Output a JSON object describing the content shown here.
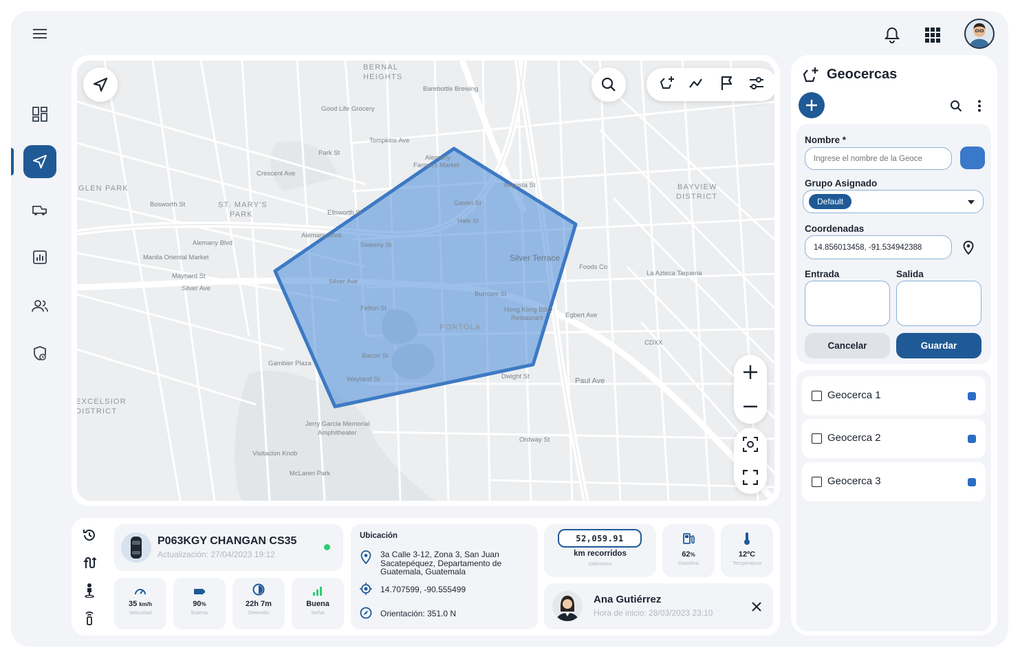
{
  "topbar": {
    "menu_icon": "hamburger-icon",
    "icons": [
      "bell-icon",
      "apps-grid-icon",
      "user-avatar"
    ]
  },
  "sidebar": {
    "items": [
      {
        "icon": "dashboard-icon",
        "active": false
      },
      {
        "icon": "navigation-icon",
        "active": true
      },
      {
        "icon": "vehicles-icon",
        "active": false
      },
      {
        "icon": "reports-icon",
        "active": false
      },
      {
        "icon": "users-icon",
        "active": false
      },
      {
        "icon": "shield-icon",
        "active": false
      }
    ]
  },
  "map": {
    "labels": [
      {
        "text": "BERNAL",
        "kind": "big"
      },
      {
        "text": "HEIGHTS",
        "kind": "big"
      },
      {
        "text": "Barebottle Brewing"
      },
      {
        "text": "Good Life Grocery"
      },
      {
        "text": "Tompkins Ave"
      },
      {
        "text": "Park St"
      },
      {
        "text": "Crescent Ave"
      },
      {
        "text": "GLEN PARK",
        "kind": "big"
      },
      {
        "text": "ST. MARY'S",
        "kind": "big"
      },
      {
        "text": "PARK",
        "kind": "big"
      },
      {
        "text": "Bosworth St"
      },
      {
        "text": "Ellsworth St"
      },
      {
        "text": "Alemany Blvd"
      },
      {
        "text": "Alemany Blvd"
      },
      {
        "text": "Manila Oriental Market"
      },
      {
        "text": "Maynard St"
      },
      {
        "text": "Silver Ave"
      },
      {
        "text": "Silver Ave"
      },
      {
        "text": "Silver Terrace"
      },
      {
        "text": "Foods Co"
      },
      {
        "text": "La Azteca Taqueria"
      },
      {
        "text": "BAYVIEW",
        "kind": "big"
      },
      {
        "text": "DISTRICT",
        "kind": "big"
      },
      {
        "text": "PORTOLA",
        "kind": "big"
      },
      {
        "text": "Hong Kong BBQ"
      },
      {
        "text": "Restaurant"
      },
      {
        "text": "Felton St"
      },
      {
        "text": "Burrows St"
      },
      {
        "text": "Bacon St"
      },
      {
        "text": "Wayland St"
      },
      {
        "text": "Gambier Plaza"
      },
      {
        "text": "Dwight St"
      },
      {
        "text": "Paul Ave"
      },
      {
        "text": "Egbert Ave"
      },
      {
        "text": "CDXX"
      },
      {
        "text": "EXCELSIOR",
        "kind": "big"
      },
      {
        "text": "DISTRICT",
        "kind": "big"
      },
      {
        "text": "Jerry Garcia Memorial"
      },
      {
        "text": "Amphitheater"
      },
      {
        "text": "Visitacion Knob"
      },
      {
        "text": "McLaren Park"
      },
      {
        "text": "Ordway St"
      },
      {
        "text": "Alemany"
      },
      {
        "text": "Farmers Market"
      },
      {
        "text": "Augusta St"
      },
      {
        "text": "Sweeny St"
      },
      {
        "text": "Gaven St"
      },
      {
        "text": "Hale St"
      }
    ],
    "search_icon": "search-icon",
    "toolbar": [
      "geofence-add-icon",
      "route-icon",
      "flag-icon",
      "filters-icon"
    ]
  },
  "vehicle": {
    "plate_model": "P063KGY CHANGAN CS35",
    "updated": "Actualización: 27/04/2023 19:12",
    "status_color": "#2ecc71",
    "stats": [
      {
        "icon": "speedometer-icon",
        "value": "35",
        "unit": "km/h",
        "label": "Velocidad"
      },
      {
        "icon": "battery-icon",
        "value": "90",
        "unit": "%",
        "label": "Batería"
      },
      {
        "icon": "timer-icon",
        "value": "22h 7m",
        "unit": "",
        "label": "Detenido"
      },
      {
        "icon": "signal-icon",
        "value": "Buena",
        "unit": "",
        "label": "Señal"
      }
    ]
  },
  "location": {
    "title": "Ubicación",
    "address": "3a Calle 3-12, Zona 3, San Juan Sacatepéquez, Departamento de Guatemala, Guatemala",
    "coords": "14.707599, -90.555499",
    "orientation": "Orientación: 351.0 N"
  },
  "odometer": {
    "value": "52,059.91",
    "label": "km recorridos",
    "sublabel": "Odómetro",
    "fuel_value": "62",
    "fuel_unit": "%",
    "fuel_label": "Gasolina",
    "temp_value": "12ºC",
    "temp_label": "Temperatura"
  },
  "driver": {
    "name": "Ana Gutiérrez",
    "start": "Hora de inicio: 28/03/2023 23:10"
  },
  "geocercas": {
    "title": "Geocercas",
    "form": {
      "name_label": "Nombre *",
      "name_placeholder": "Ingrese el nombre de la Geoce",
      "color": "#3a78c9",
      "group_label": "Grupo Asignado",
      "group_value": "Default",
      "coords_label": "Coordenadas",
      "coords_value": "14.856013458, -91.534942388",
      "in_label": "Entrada",
      "out_label": "Salida",
      "cancel": "Cancelar",
      "save": "Guardar"
    },
    "items": [
      {
        "name": "Geocerca 1",
        "color": "#2b6cc4"
      },
      {
        "name": "Geocerca 2",
        "color": "#2b6cc4"
      },
      {
        "name": "Geocerca 3",
        "color": "#2b6cc4"
      }
    ]
  }
}
